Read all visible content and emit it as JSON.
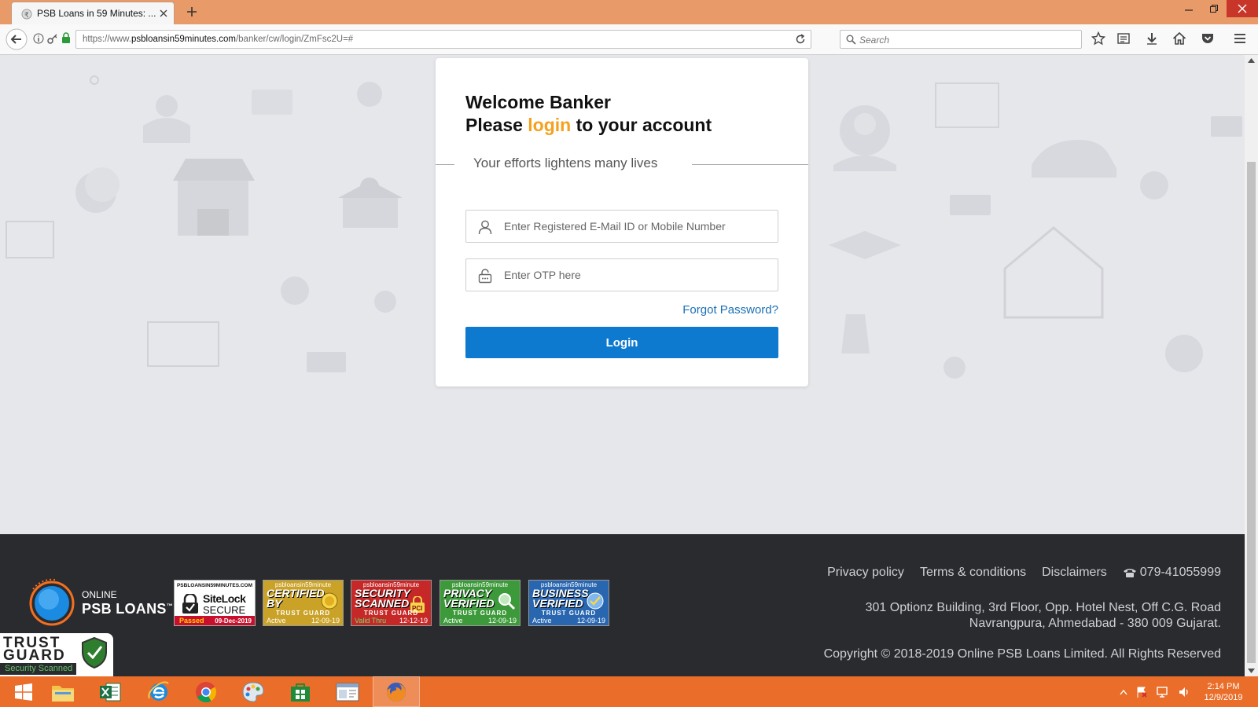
{
  "browser": {
    "tab_title": "PSB Loans in 59 Minutes: ...",
    "url_prefix": "https://www.",
    "url_domain": "psbloansin59minutes.com",
    "url_path": "/banker/cw/login/ZmFsc2U=#",
    "search_placeholder": "Search"
  },
  "login": {
    "welcome": "Welcome Banker",
    "please": "Please ",
    "login_word": "login",
    "account_suffix": " to your account",
    "tagline": "Your efforts lightens many lives",
    "email_placeholder": "Enter Registered E-Mail ID or Mobile Number",
    "otp_placeholder": "Enter OTP here",
    "forgot": "Forgot Password?",
    "button": "Login"
  },
  "footer": {
    "logo_online": "ONLINE",
    "logo_psb": "PSB LOANS",
    "logo_tm": "™",
    "links": [
      "Privacy policy",
      "Terms & conditions",
      "Disclaimers"
    ],
    "phone": "079-41055999",
    "address_line1": "301 Optionz Building, 3rd Floor, Opp. Hotel Nest, Off C.G. Road",
    "address_line2": "Navrangpura, Ahmedabad - 380 009 Gujarat.",
    "copyright": "Copyright © 2018-2019 Online PSB Loans Limited. All Rights Reserved",
    "sitelock": {
      "domain": "PSBLOANSIN59MINUTES.COM",
      "name1": "SiteLock",
      "name2": "SECURE",
      "status": "Passed",
      "date": "09-Dec-2019"
    },
    "badges": [
      {
        "domain": "psbloansin59minute",
        "title1": "CERTIFIED",
        "title2": "BY",
        "brand": "TRUST GUARD",
        "status": "Active",
        "date": "12-09-19",
        "color": "#c9a227"
      },
      {
        "domain": "psbloansin59minute",
        "title1": "SECURITY",
        "title2": "SCANNED",
        "brand": "TRUST GUARD",
        "status": "Valid Thru",
        "date": "12-12-19",
        "color": "#c62828"
      },
      {
        "domain": "psbloansin59minute",
        "title1": "PRIVACY",
        "title2": "VERIFIED",
        "brand": "TRUST GUARD",
        "status": "Active",
        "date": "12-09-19",
        "color": "#3d9a3a"
      },
      {
        "domain": "psbloansin59minute",
        "title1": "BUSINESS",
        "title2": "VERIFIED",
        "brand": "TRUST GUARD",
        "status": "Active",
        "date": "12-09-19",
        "color": "#2966b0"
      }
    ],
    "trustguard": {
      "line1": "TRUST",
      "line2": "GUARD",
      "line3": "Security Scanned"
    }
  },
  "taskbar": {
    "time": "2:14 PM",
    "date": "12/9/2019"
  },
  "colors": {
    "accent_orange": "#f5a11c",
    "button_blue": "#0d7ad0",
    "footer_bg": "#2a2b2f",
    "titlebar": "#e89a68",
    "taskbar": "#ea6e2a"
  }
}
